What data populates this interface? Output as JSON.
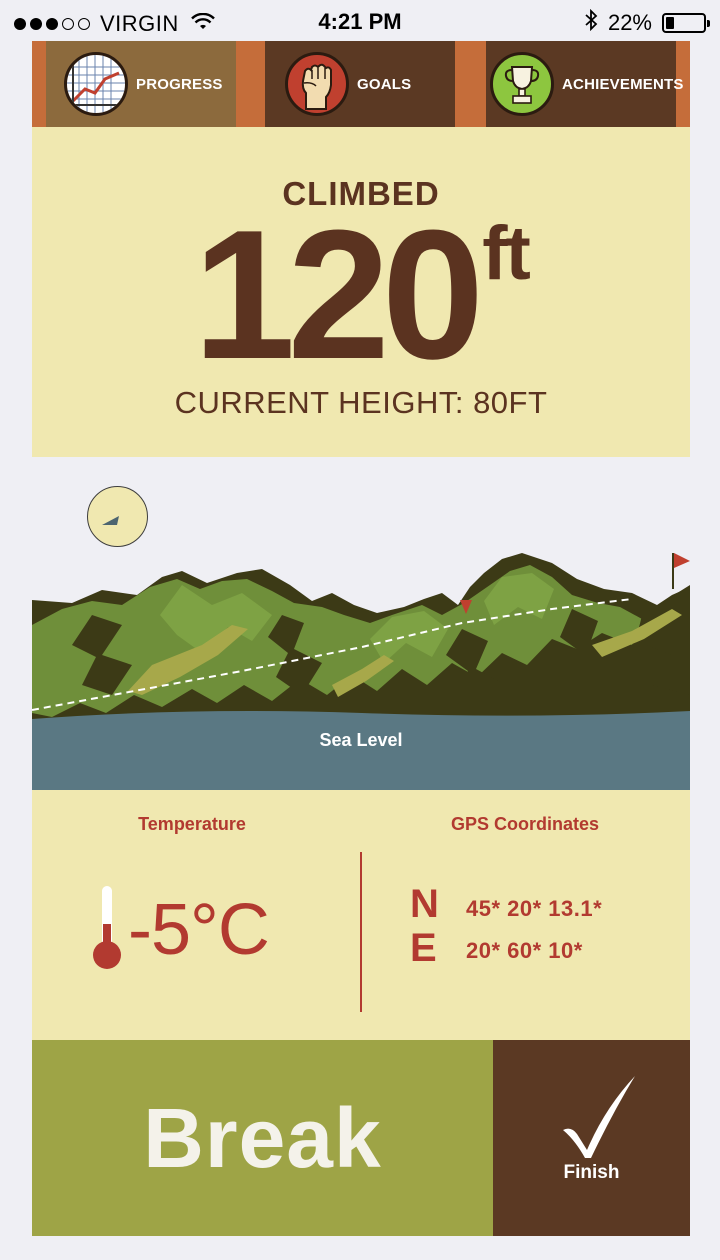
{
  "status_bar": {
    "carrier": "VIRGIN",
    "time": "4:21 PM",
    "battery": "22%",
    "battery_level": 0.22,
    "signal_bars_filled": 3,
    "signal_bars_total": 5,
    "icons": [
      "wifi-icon",
      "bluetooth-icon",
      "battery-icon"
    ]
  },
  "tabs": [
    {
      "label": "PROGRESS",
      "icon": "chart-icon"
    },
    {
      "label": "GOALS",
      "icon": "fist-icon"
    },
    {
      "label": "ACHIEVEMENTS",
      "icon": "trophy-icon"
    }
  ],
  "climb": {
    "label": "CLIMBED",
    "value": "120",
    "unit": "ft",
    "current_height": "CURRENT HEIGHT: 80FT"
  },
  "map": {
    "sea_label": "Sea Level",
    "compass_icon": "compass-icon",
    "flag_icon": "flag-icon"
  },
  "temperature": {
    "title": "Temperature",
    "value": "-5°C",
    "icon": "thermometer-icon"
  },
  "gps": {
    "title": "GPS Coordinates",
    "n_label": "N",
    "n_value": "45* 20* 13.1*",
    "e_label": "E",
    "e_value": "20* 60* 10*"
  },
  "actions": {
    "break_label": "Break",
    "finish_label": "Finish",
    "finish_icon": "checkmark-icon"
  },
  "colors": {
    "brown": "#5b3923",
    "orange": "#c56d3a",
    "cream": "#f0e8b0",
    "red": "#b23a30",
    "olive": "#9ea446",
    "sea": "#5a7883",
    "mountain_green": "#6f8f3a",
    "mountain_dark": "#3c3a16"
  }
}
